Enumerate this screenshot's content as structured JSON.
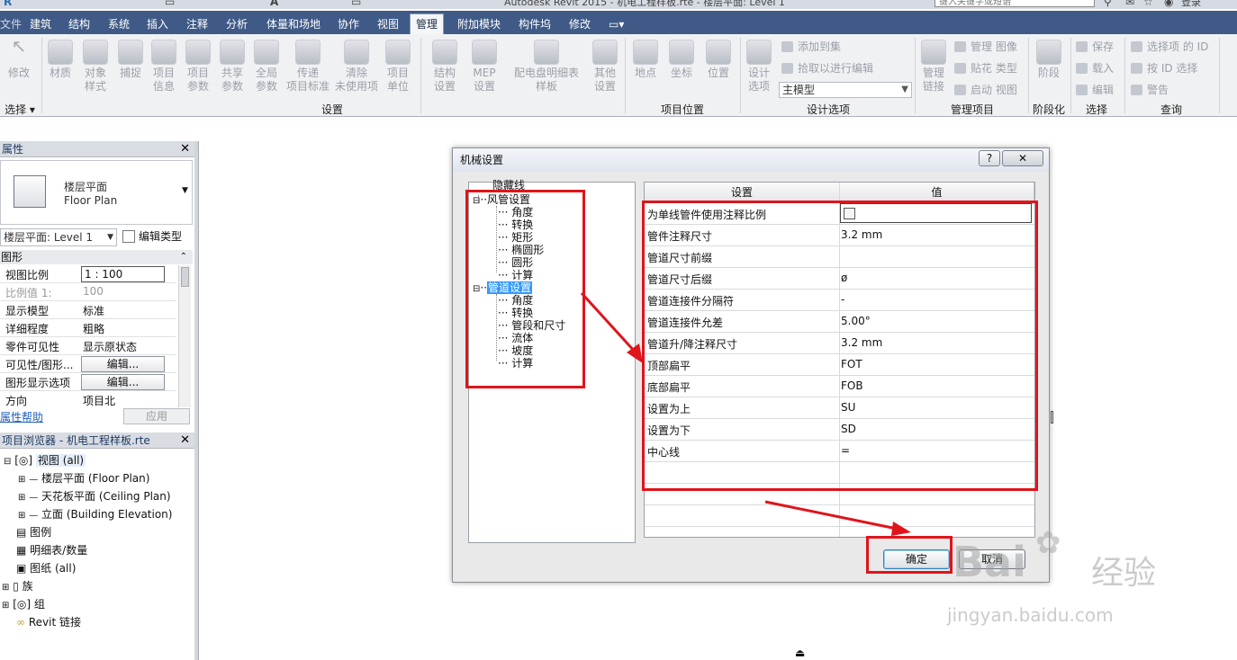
{
  "title_bar": {
    "text": "Autodesk Revit 2015  -  机电工程样板.rte - 楼层平面: Level 1",
    "search_placeholder": "键入关键字或短语",
    "login": "登录"
  },
  "tabs": [
    "文件",
    "建筑",
    "结构",
    "系统",
    "插入",
    "注释",
    "分析",
    "体量和场地",
    "协作",
    "视图",
    "管理",
    "附加模块",
    "构件坞",
    "修改"
  ],
  "active_tab": "管理",
  "ribbon": {
    "select_label": "修改",
    "select_group": "选择",
    "settings_items": [
      "材质",
      "对象\n样式",
      "捕捉",
      "项目\n信息",
      "项目\n参数",
      "共享\n参数",
      "全局\n参数",
      "传递\n项目标准",
      "清除\n未使用项",
      "项目\n单位",
      "结构\n设置",
      "MEP\n设置",
      "配电盘明细表\n样板",
      "其他\n设置"
    ],
    "settings_group": "设置",
    "location_items": [
      "地点",
      "坐标",
      "位置"
    ],
    "location_group": "项目位置",
    "design_options": {
      "big": "设计\n选项",
      "add": "添加到集",
      "pick": "拾取以进行编辑",
      "combo": "主模型",
      "group": "设计选项"
    },
    "manage_project": {
      "big": "管理\n链接",
      "items": [
        "管理 图像",
        "贴花 类型",
        "启动 视图"
      ],
      "group": "管理项目"
    },
    "phasing": {
      "big": "阶段",
      "group": "阶段化"
    },
    "selection": {
      "items": [
        "保存",
        "载入",
        "编辑"
      ],
      "group": "选择"
    },
    "inquiry": {
      "items": [
        "选择项 的 ID",
        "按 ID 选择",
        "警告"
      ],
      "group": "查询"
    }
  },
  "properties": {
    "title": "属性",
    "type_name": "楼层平面",
    "type_sub": "Floor Plan",
    "selector": "楼层平面: Level 1",
    "edit_type": "编辑类型",
    "section": "图形",
    "rows": [
      {
        "k": "视图比例",
        "v": "1 : 100"
      },
      {
        "k": "比例值 1:",
        "v": "100"
      },
      {
        "k": "显示模型",
        "v": "标准"
      },
      {
        "k": "详细程度",
        "v": "粗略"
      },
      {
        "k": "零件可见性",
        "v": "显示原状态"
      },
      {
        "k": "可见性/图形...",
        "v": "编辑..."
      },
      {
        "k": "图形显示选项",
        "v": "编辑..."
      },
      {
        "k": "方向",
        "v": "项目北"
      }
    ],
    "help": "属性帮助",
    "apply": "应用"
  },
  "browser": {
    "title": "项目浏览器 - 机电工程样板.rte",
    "items": [
      "视图 (all)",
      "楼层平面 (Floor Plan)",
      "天花板平面 (Ceiling Plan)",
      "立面 (Building Elevation)",
      "图例",
      "明细表/数量",
      "图纸 (all)",
      "族",
      "组",
      "Revit 链接"
    ]
  },
  "dialog": {
    "title": "机械设置",
    "help_btn": "?",
    "close_btn": "✕",
    "tree": [
      "隐藏线",
      "风管设置",
      "角度",
      "转换",
      "矩形",
      "椭圆形",
      "圆形",
      "计算",
      "管道设置",
      "角度",
      "转换",
      "管段和尺寸",
      "流体",
      "坡度",
      "计算"
    ],
    "col_setting": "设置",
    "col_value": "值",
    "rows": [
      {
        "s": "为单线管件使用注释比例",
        "v": ""
      },
      {
        "s": "管件注释尺寸",
        "v": "3.2 mm"
      },
      {
        "s": "管道尺寸前缀",
        "v": ""
      },
      {
        "s": "管道尺寸后缀",
        "v": "ø"
      },
      {
        "s": "管道连接件分隔符",
        "v": "-"
      },
      {
        "s": "管道连接件允差",
        "v": "5.00°"
      },
      {
        "s": "管道升/降注释尺寸",
        "v": "3.2 mm"
      },
      {
        "s": "顶部扁平",
        "v": "FOT"
      },
      {
        "s": "底部扁平",
        "v": "FOB"
      },
      {
        "s": "设置为上",
        "v": "SU"
      },
      {
        "s": "设置为下",
        "v": "SD"
      },
      {
        "s": "中心线",
        "v": "="
      }
    ],
    "ok": "确定",
    "cancel": "取消"
  },
  "watermark": {
    "brand": "Bai",
    "site": "经验",
    "url": "jingyan.baidu.com"
  },
  "colors": {
    "tab_bar": "#3f5a86",
    "annotation_red": "#e0141b",
    "selected": "#3399ff"
  }
}
